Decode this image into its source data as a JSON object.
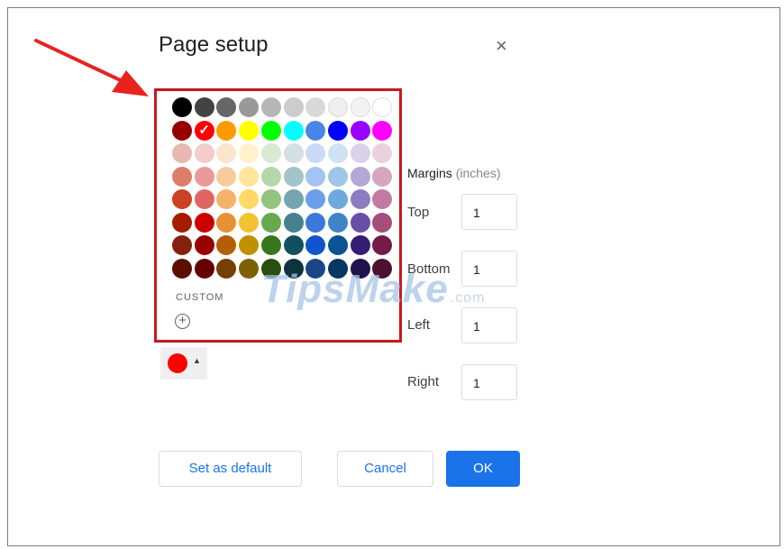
{
  "dialog": {
    "title": "Page setup",
    "close_icon": "×"
  },
  "palette": {
    "custom_label": "CUSTOM",
    "add_icon": "+",
    "selected_color": "#ff0000",
    "rows": [
      [
        "#000000",
        "#434343",
        "#666666",
        "#999999",
        "#b7b7b7",
        "#cccccc",
        "#d9d9d9",
        "#efefef",
        "#f3f3f3",
        "#ffffff"
      ],
      [
        "#980000",
        "#ff0000",
        "#ff9900",
        "#ffff00",
        "#00ff00",
        "#00ffff",
        "#4a86e8",
        "#0000ff",
        "#9900ff",
        "#ff00ff"
      ],
      [
        "#e6b8af",
        "#f4cccc",
        "#fce5cd",
        "#fff2cc",
        "#d9ead3",
        "#d0e0e3",
        "#c9daf8",
        "#cfe2f3",
        "#d9d2e9",
        "#ead1dc"
      ],
      [
        "#dd7e6b",
        "#ea9999",
        "#f9cb9c",
        "#ffe599",
        "#b6d7a8",
        "#a2c4c9",
        "#a4c2f4",
        "#9fc5e8",
        "#b4a7d6",
        "#d5a6bd"
      ],
      [
        "#cc4125",
        "#e06666",
        "#f6b26b",
        "#ffd966",
        "#93c47d",
        "#76a5af",
        "#6d9eeb",
        "#6fa8dc",
        "#8e7cc3",
        "#c27ba0"
      ],
      [
        "#a61c00",
        "#cc0000",
        "#e69138",
        "#f1c232",
        "#6aa84f",
        "#45818e",
        "#3c78d8",
        "#3d85c6",
        "#674ea7",
        "#a64d79"
      ],
      [
        "#85200c",
        "#990000",
        "#b45f06",
        "#bf9000",
        "#38761d",
        "#134f5c",
        "#1155cc",
        "#0b5394",
        "#351c75",
        "#741b47"
      ],
      [
        "#5b0f00",
        "#660000",
        "#783f04",
        "#7f6000",
        "#274e13",
        "#0c343d",
        "#1c4587",
        "#073763",
        "#20124d",
        "#4c1130"
      ]
    ]
  },
  "color_button": {
    "swatch_color": "#ff0000",
    "caret": "▲"
  },
  "margins": {
    "heading": "Margins",
    "unit": "(inches)",
    "top_label": "Top",
    "top_value": "1",
    "bottom_label": "Bottom",
    "bottom_value": "1",
    "left_label": "Left",
    "left_value": "1",
    "right_label": "Right",
    "right_value": "1"
  },
  "buttons": {
    "set_default": "Set as default",
    "cancel": "Cancel",
    "ok": "OK"
  },
  "watermark": {
    "text": "TipsMake",
    "suffix": ".com"
  },
  "colors": {
    "highlight_border": "#c9171e",
    "annotation_arrow": "#e8231e",
    "primary_button": "#1a73e8"
  }
}
